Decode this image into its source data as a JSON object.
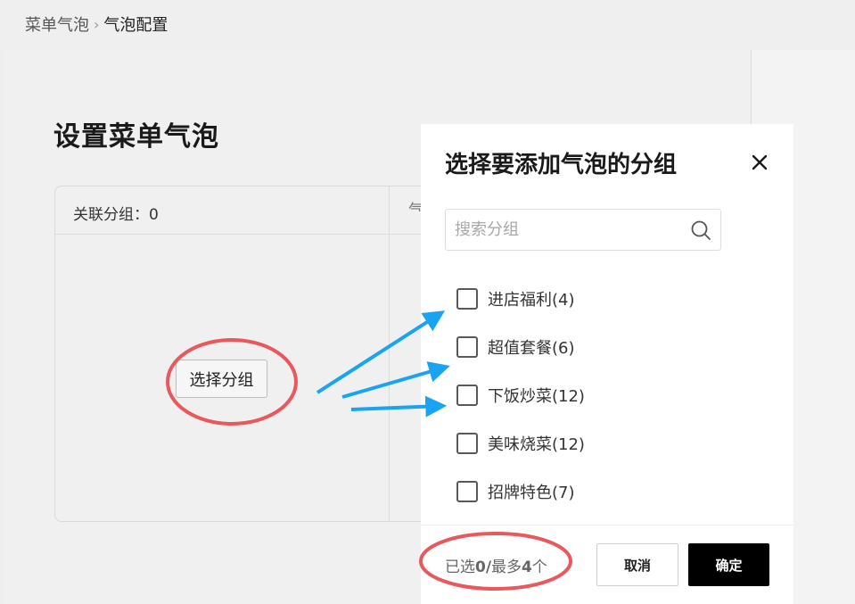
{
  "breadcrumb": {
    "parent": "菜单气泡",
    "separator": "›",
    "current": "气泡配置"
  },
  "page": {
    "title": "设置菜单气泡",
    "assoc_count_label": "关联分组：0",
    "col2_header_partial": "气",
    "select_group_button": "选择分组"
  },
  "modal": {
    "title": "选择要添加气泡的分组",
    "close_icon": "close-icon",
    "search": {
      "placeholder": "搜索分组",
      "value": "",
      "icon": "search-icon"
    },
    "groups": [
      {
        "label": "进店福利(4)",
        "checked": false
      },
      {
        "label": "超值套餐(6)",
        "checked": false
      },
      {
        "label": "下饭炒菜(12)",
        "checked": false
      },
      {
        "label": "美味烧菜(12)",
        "checked": false
      },
      {
        "label": "招牌特色(7)",
        "checked": false
      }
    ],
    "footer": {
      "selected_prefix": "已选",
      "selected_count": "0/",
      "max_prefix": "最多",
      "max_count": "4",
      "max_suffix": "个",
      "cancel_label": "取消",
      "confirm_label": "确定"
    }
  },
  "annotations": {
    "highlight_color": "#e8585c",
    "arrow_color": "#1aa3f0"
  },
  "colors": {
    "background": "#efefef",
    "modal_bg": "#ffffff",
    "confirm_bg": "#000000"
  }
}
